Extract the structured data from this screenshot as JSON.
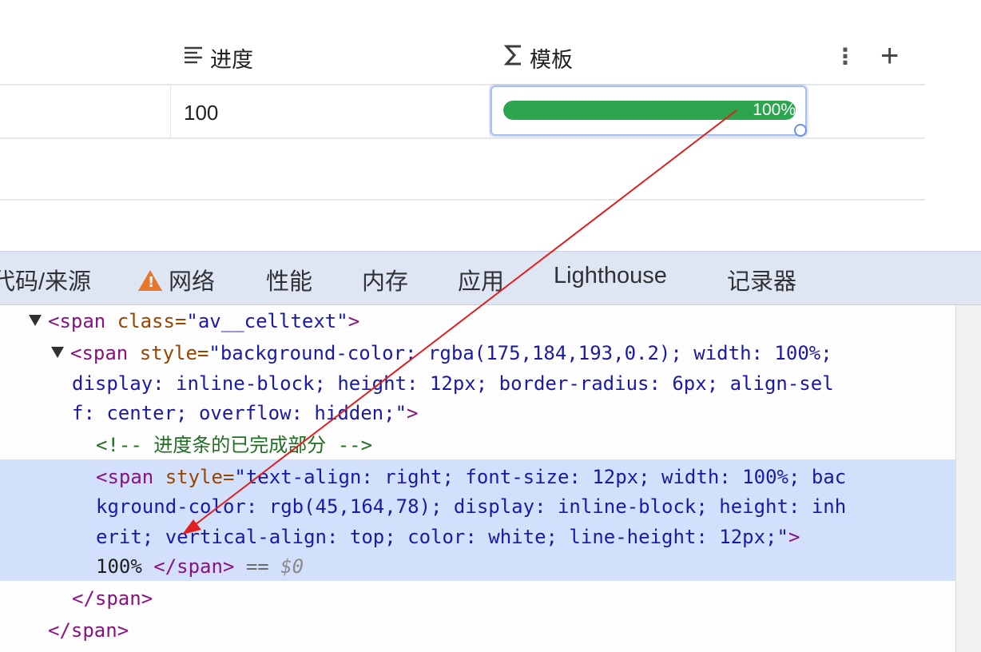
{
  "table": {
    "columns": [
      {
        "label": "进度",
        "icon": "text-align-icon"
      },
      {
        "label": "模板",
        "icon": "sigma-icon"
      }
    ],
    "more_icon": "⋮",
    "add_icon": "+",
    "row": {
      "progress_value": "100",
      "template_progress": "100%",
      "template_progress_fraction": 1.0
    }
  },
  "devtools": {
    "tabs": [
      "代码/来源",
      "网络",
      "性能",
      "内存",
      "应用",
      "Lighthouse",
      "记录器"
    ],
    "warning_tab_index": 1,
    "code": {
      "l1_tag": "<span ",
      "l1_attr": "class=",
      "l1_val": "\"av__celltext\"",
      "l1_end": ">",
      "l2_tag": "<span ",
      "l2_attr": "style=",
      "l2_val": "\"background-color: rgba(175,184,193,0.2); width: 100%;",
      "l3_val": "display: inline-block; height: 12px; border-radius: 6px; align-sel",
      "l4_val": "f: center; overflow: hidden;\"",
      "l4_end": ">",
      "l5_comment": "<!-- 进度条的已完成部分 -->",
      "l6_tag": "<span ",
      "l6_attr": "style=",
      "l6_val": "\"text-align: right; font-size: 12px; width: 100%; bac",
      "l7_val": "kground-color: rgb(45,164,78); display: inline-block; height: inh",
      "l8_val": "erit; vertical-align: top; color: white; line-height: 12px;\"",
      "l8_end": ">",
      "l9_text": "100% ",
      "l9_close": "</span>",
      "l9_eq": " == ",
      "l9_ref": "$0",
      "l10_close": "</span>",
      "l11_close": "</span>"
    }
  },
  "colors": {
    "progress_fill": "#2da44e",
    "annotation_arrow": "#e02020",
    "selection": "#d3e0fb"
  }
}
